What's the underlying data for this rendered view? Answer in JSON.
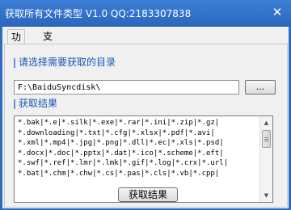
{
  "window": {
    "title": "获取所有文件类型 V1.0 QQ:2183307838",
    "close_icon": "close-icon",
    "accent_color": "#2b6cc4"
  },
  "tabs": [
    {
      "label": "功能",
      "active": true
    },
    {
      "label": "支持",
      "active": false
    }
  ],
  "directory_section": {
    "label": "请选择需要获取的目录",
    "path_value": "F:\\BaiduSyncdisk\\",
    "browse_label": "..."
  },
  "result_section": {
    "label": "获取结果",
    "lines": [
      "*.bak|*.e|*.silk|*.exe|*.rar|*.ini|*.zip|*.gz|",
      "*.downloading|*.txt|*.cfg|*.xlsx|*.pdf|*.avi|",
      "*.xml|*.mp4|*.jpg|*.png|*.dll|*.ec|*.xls|*.psd|",
      "*.docx|*.doc|*.pptx|*.dat|*.ico|*.scheme|*.eft|",
      "*.swf|*.ref|*.lmr|*.lmk|*.gif|*.log|*.crx|*.url|",
      "*.bat|*.chm|*.chw|*.cs|*.pas|*.cls|*.vb|*.cpp|"
    ],
    "label_color": "#1a57b5"
  },
  "fetch_button": {
    "label": "获取结果"
  }
}
